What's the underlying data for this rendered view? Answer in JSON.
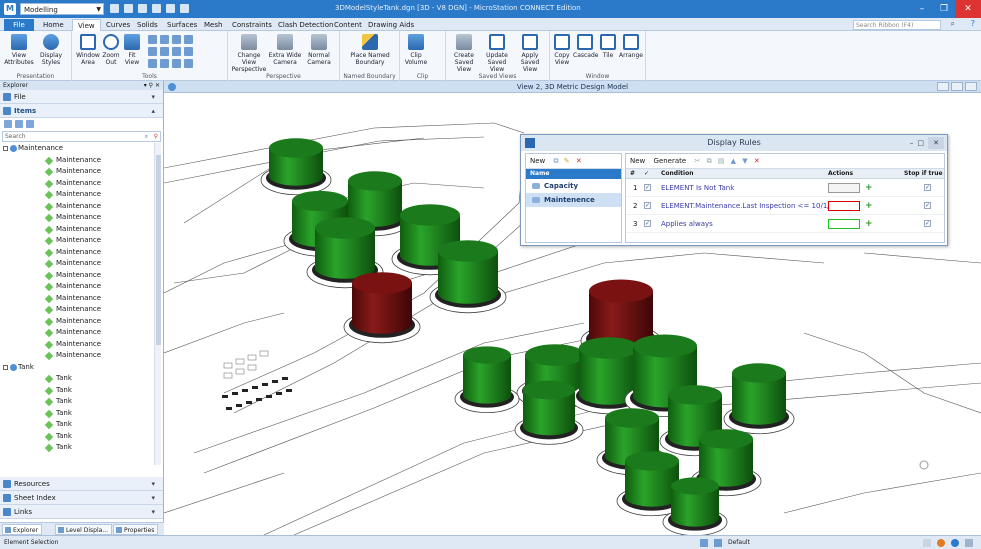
{
  "window": {
    "workflow": "Modelling",
    "title": "3DModelStyleTank.dgn [3D - V8 DGN] - MicroStation CONNECT Edition"
  },
  "tabs": [
    "File",
    "Home",
    "View",
    "Curves",
    "Solids",
    "Surfaces",
    "Mesh",
    "Constraints",
    "Clash Detection",
    "Content",
    "Drawing Aids"
  ],
  "active_tab": "View",
  "search_ribbon_placeholder": "Search Ribbon (F4)",
  "ribbon": {
    "presentation": {
      "label": "Presentation",
      "buttons": [
        "View Attributes",
        "Display Styles"
      ]
    },
    "tools": {
      "label": "Tools",
      "buttons": [
        "Window Area",
        "Zoom Out",
        "Fit View"
      ]
    },
    "perspective": {
      "label": "Perspective",
      "buttons": [
        "Change View Perspective",
        "Extra Wide Camera",
        "Normal Camera"
      ]
    },
    "named_boundary": {
      "label": "Named Boundary",
      "buttons": [
        "Place Named Boundary"
      ]
    },
    "clip": {
      "label": "Clip",
      "buttons": [
        "Clip Volume"
      ]
    },
    "saved_views": {
      "label": "Saved Views",
      "buttons": [
        "Create Saved View",
        "Update Saved View",
        "Apply Saved View"
      ]
    },
    "window": {
      "label": "Window",
      "buttons": [
        "Copy View",
        "Cascade",
        "Tile",
        "Arrange"
      ]
    }
  },
  "explorer": {
    "title": "Explorer",
    "sections_top": [
      "File",
      "Items"
    ],
    "search_placeholder": "Search",
    "tree": [
      {
        "type": "group",
        "label": "Maintenance"
      },
      {
        "type": "leaf",
        "label": "Maintenance"
      },
      {
        "type": "leaf",
        "label": "Maintenance"
      },
      {
        "type": "leaf",
        "label": "Maintenance"
      },
      {
        "type": "leaf",
        "label": "Maintenance"
      },
      {
        "type": "leaf",
        "label": "Maintenance"
      },
      {
        "type": "leaf",
        "label": "Maintenance"
      },
      {
        "type": "leaf",
        "label": "Maintenance"
      },
      {
        "type": "leaf",
        "label": "Maintenance"
      },
      {
        "type": "leaf",
        "label": "Maintenance"
      },
      {
        "type": "leaf",
        "label": "Maintenance"
      },
      {
        "type": "leaf",
        "label": "Maintenance"
      },
      {
        "type": "leaf",
        "label": "Maintenance"
      },
      {
        "type": "leaf",
        "label": "Maintenance"
      },
      {
        "type": "leaf",
        "label": "Maintenance"
      },
      {
        "type": "leaf",
        "label": "Maintenance"
      },
      {
        "type": "leaf",
        "label": "Maintenance"
      },
      {
        "type": "leaf",
        "label": "Maintenance"
      },
      {
        "type": "leaf",
        "label": "Maintenance"
      },
      {
        "type": "group",
        "label": "Tank"
      },
      {
        "type": "leaf",
        "label": "Tank"
      },
      {
        "type": "leaf",
        "label": "Tank"
      },
      {
        "type": "leaf",
        "label": "Tank"
      },
      {
        "type": "leaf",
        "label": "Tank"
      },
      {
        "type": "leaf",
        "label": "Tank"
      },
      {
        "type": "leaf",
        "label": "Tank"
      },
      {
        "type": "leaf",
        "label": "Tank"
      }
    ],
    "sections_bottom": [
      "Resources",
      "Sheet Index",
      "Links"
    ],
    "bottom_tabs": [
      "Explorer",
      "Level Displa...",
      "Properties"
    ]
  },
  "view": {
    "title": "View 2, 3D Metric Design Model"
  },
  "dialog": {
    "title": "Display Rules",
    "left_toolbar_new": "New",
    "name_header": "Name",
    "rule_sets": [
      "Capacity",
      "Maintenence"
    ],
    "selected_rule_set": "Maintenence",
    "right_toolbar_new": "New",
    "right_toolbar_generate": "Generate",
    "headers": {
      "num": "#",
      "check": "✓",
      "condition": "Condition",
      "actions": "Actions",
      "stop": "Stop if true"
    },
    "rules": [
      {
        "num": "1",
        "condition": "ELEMENT Is Not Tank",
        "action_color": "#9a9a9a",
        "swatch_fill": "#f4f4f4"
      },
      {
        "num": "2",
        "condition": "ELEMENT.Maintenance.Last Inspection <= 10/1/2014",
        "action_color": "#d40000",
        "swatch_fill": "#ffffff"
      },
      {
        "num": "3",
        "condition": "Applies always",
        "action_color": "#22c022",
        "swatch_fill": "#ffffff"
      }
    ]
  },
  "status": {
    "message": "Element Selection",
    "level": "Default"
  },
  "colors": {
    "accent": "#2b79c9",
    "tank_green": "#1f8a1f",
    "tank_red": "#7a1010"
  }
}
